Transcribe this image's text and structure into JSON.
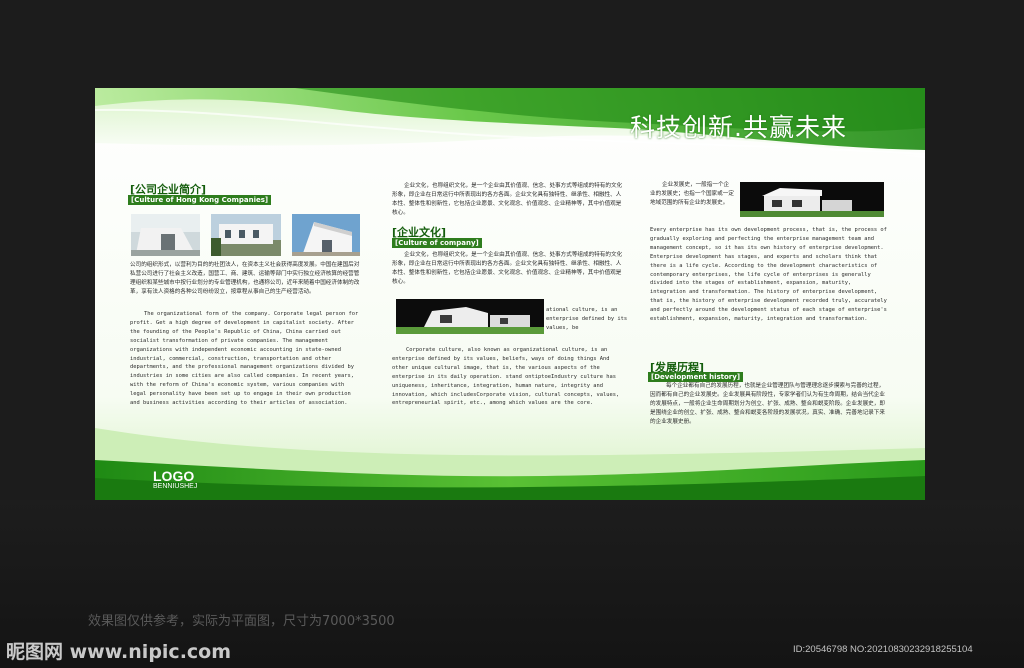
{
  "slogan": "科技创新.共赢未来",
  "logo": {
    "text": "LOGO",
    "sub": "BENNIUSHEJ"
  },
  "section1": {
    "title_cn": "[公司企业简介]",
    "title_en": "[Culture of Hong Kong Companies]",
    "body_cn": "公司的组织形式，以营利为目的的社团法人，在资本主义社会获得高度发展。中国在建国后对私营公司进行了社会主义改造，国营工、商、建筑、运输等部门中实行独立经济核算的经营管理组织和某些城市中按行业划分的专业管理机构，也通称公司，近年来随着中国经济体制的改革，享有法人资格的各种公司纷纷设立，按章程从事自己的生产经营活动。",
    "body_en": "The organizational form of the company. Corporate legal person for profit. Get a high degree of development in capitalist society. After the founding of the People's Republic of China, China carried out socialist transformation of private companies. The management organizations with independent economic accounting in state-owned industrial, commercial, construction, transportation and other departments, and the professional management organizations divided by industries in some cities are also called companies. In recent years, with the reform of China's economic system, various companies with legal personality have been set up to engage in their own production and business activities according to their articles of association."
  },
  "section2": {
    "title_cn": "[企业文化]",
    "title_en": "[Culture of company]",
    "body_cn_top": "企业文化，也称组织文化，是一个企业由其价值观、信念、处事方式等组成的特有的文化形象，即企业在日常运行中所表现出的各方各面。企业文化具有独特性、继承性、相融性、人本性、整体性和创新性，它包括企业愿景、文化观念、价值观念、企业精神等，其中价值观是核心。",
    "body_cn_mid": "企业文化，也称组织文化，是一个企业由其价值观、信念、处事方式等组成的特有的文化形象，即企业在日常运行中所表现出的各方各面。企业文化具有独特性、继承性、相融性、人本性、整体性和创新性，它包括企业愿景、文化观念、价值观念、企业精神等，其中价值观是核心。",
    "body_en_side": "ational culture, is an enterprise defined by its values, be",
    "body_en": "Corporate culture, also known as organizational culture, is an enterprise defined by its values, beliefs, ways of doing things And other unique cultural image, that is, the various aspects of the enterprise in its daily operation. stand ontiptoeIndustry culture has uniqueness, inheritance, integration, human nature, integrity and innovation, which includesCorporate vision, cultural concepts, values, entrepreneurial spirit, etc., among which values are the core."
  },
  "section3": {
    "body_cn_top": "企业发展史，一般指一个企业的发展史；也指一个国家或一定地域范围的所有企业的发展史。",
    "body_en": "Every enterprise has its own development process, that is, the process of gradually exploring and perfecting the enterprise management team and management concept, so it has its own history of enterprise development. Enterprise development has stages, and experts and scholars think that there is a life cycle. According to the development characteristics of contemporary enterprises, the life cycle of enterprises is generally divided into the stages of establishment, expansion, maturity, integration and transformation. The history of enterprise development, that is, the history of enterprise development recorded truly, accurately and perfectly around the development status of each stage of enterprise's establishment, expansion, maturity, integration and transformation.",
    "title_cn": "[发展历程]",
    "title_en": "[Development history]",
    "body_cn": "每个企业都有自己的发展历程，也就是企业管理团队与管理理念逐步摸索与完善的过程，因而都有自己的企业发展史。企业发展具有阶段性，专家学者们认为有生命周期，结合当代企业的发展特点，一般将企业生命周期划分为创立、扩张、成熟、整合和蜕变阶段。企业发展史，即是围绕企业的创立、扩张、成熟、整合和蜕变各阶段的发展状况，真实、准确、完善地记录下来的企业发展史册。"
  },
  "caption": "效果图仅供参考，实际为平面图，尺寸为7000*3500",
  "watermark": {
    "site": "昵图网 www.nipic.com",
    "id": "ID:20546798 NO:20210830232918255104"
  },
  "colors": {
    "green_dark": "#2a8a1c",
    "green_light": "#8fd66f",
    "heading": "#155e0d"
  }
}
